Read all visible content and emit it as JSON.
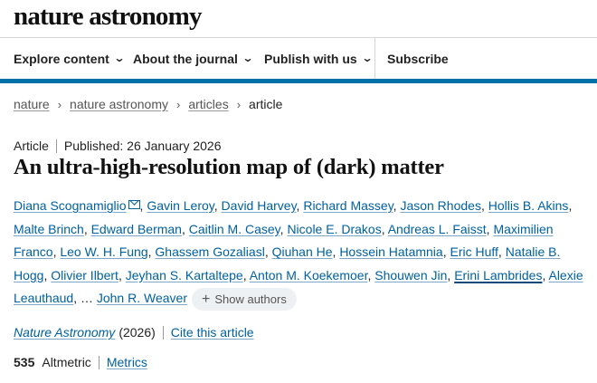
{
  "header": {
    "logo": "nature astronomy",
    "nav": [
      {
        "label": "Explore content",
        "chevron": "⌄"
      },
      {
        "label": "About the journal",
        "chevron": "⌄"
      },
      {
        "label": "Publish with us",
        "chevron": "⌄"
      },
      {
        "label": "Subscribe"
      }
    ]
  },
  "breadcrumb": {
    "items": [
      "nature",
      "nature astronomy",
      "articles"
    ],
    "current": "article",
    "separator": "›"
  },
  "article": {
    "type": "Article",
    "published": "Published: 26 January 2026",
    "title": "An ultra-high-resolution map of (dark) matter",
    "authors": [
      "Diana Scognamiglio",
      "Gavin Leroy",
      "David Harvey",
      "Richard Massey",
      "Jason Rhodes",
      "Hollis B. Akins",
      "Malte Brinch",
      "Edward Berman",
      "Caitlin M. Casey",
      "Nicole E. Drakos",
      "Andreas L. Faisst",
      "Maximilien Franco",
      "Leo W. H. Fung",
      "Ghassem Gozaliasl",
      "Qiuhan He",
      "Hossein Hatamnia",
      "Eric Huff",
      "Natalie B. Hogg",
      "Olivier Ilbert",
      "Jeyhan S. Kartaltepe",
      "Anton M. Koekemoer",
      "Shouwen Jin",
      "Erini Lambrides",
      "Alexie Leauthaud",
      "John R. Weaver"
    ],
    "ellipsis": "…",
    "show_authors": "Show authors",
    "journal": "Nature Astronomy",
    "year": "(2026)",
    "cite": "Cite this article",
    "altmetric_score": "535",
    "altmetric_label": "Altmetric",
    "metrics": "Metrics"
  },
  "colors": {
    "link": "#0060a0",
    "accent_bar": "#0070a8"
  },
  "icons": {
    "mail": "envelope-icon",
    "nav_chevron": "chevron-down-icon",
    "breadcrumb_separator": "chevron-right-icon",
    "show_authors": "plus-icon"
  }
}
